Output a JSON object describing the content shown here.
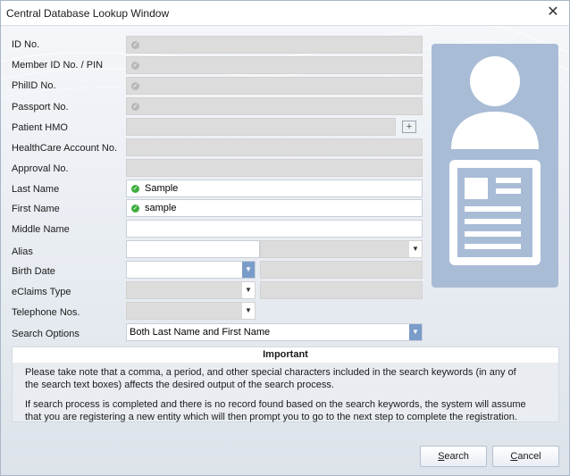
{
  "window": {
    "title": "Central Database Lookup Window",
    "close_glyph": "✕"
  },
  "form": {
    "id_no": {
      "label": "ID No.",
      "value": ""
    },
    "member_id": {
      "label": "Member ID No. / PIN",
      "value": ""
    },
    "phil_id": {
      "label": "PhilID No.",
      "value": ""
    },
    "passport": {
      "label": "Passport No.",
      "value": ""
    },
    "patient_hmo": {
      "label": "Patient HMO",
      "value": "",
      "add_icon": "plus-icon"
    },
    "healthcare_account": {
      "label": "HealthCare Account No.",
      "value": ""
    },
    "approval_no": {
      "label": "Approval No.",
      "value": ""
    },
    "last_name": {
      "label": "Last Name",
      "value": "Sample"
    },
    "first_name": {
      "label": "First Name",
      "value": "sample"
    },
    "middle_name": {
      "label": "Middle Name",
      "value": ""
    },
    "alias": {
      "label": "Alias",
      "value": "",
      "type_value": ""
    },
    "birth_date": {
      "label": "Birth Date",
      "value": "",
      "age_value": ""
    },
    "eclaims_type": {
      "label": "eClaims Type",
      "value": "",
      "extra_value": ""
    },
    "telephone": {
      "label": "Telephone Nos.",
      "value": ""
    },
    "search_options": {
      "label": "Search Options",
      "value": "Both Last Name and First Name"
    }
  },
  "photo": {
    "icon": "person-id-card-icon"
  },
  "important": {
    "heading": "Important",
    "para1_line1": "Please take note that a comma, a period, and other special characters included in the search keywords (in any of",
    "para1_line2": "the search text boxes) affects the desired output of the search process.",
    "para2_line1": "If search process is completed and there is no record found based on the search keywords, the system will assume",
    "para2_line2": "that you are registering a new entity which will then prompt you to go to the next step to complete the registration."
  },
  "buttons": {
    "search": {
      "first": "S",
      "rest": "earch"
    },
    "cancel": {
      "first": "C",
      "rest": "ancel"
    }
  },
  "colors": {
    "valid_check": "#3fae3f",
    "disabled_field": "#dcdcdc",
    "photo_bg": "#a8bcd6"
  }
}
